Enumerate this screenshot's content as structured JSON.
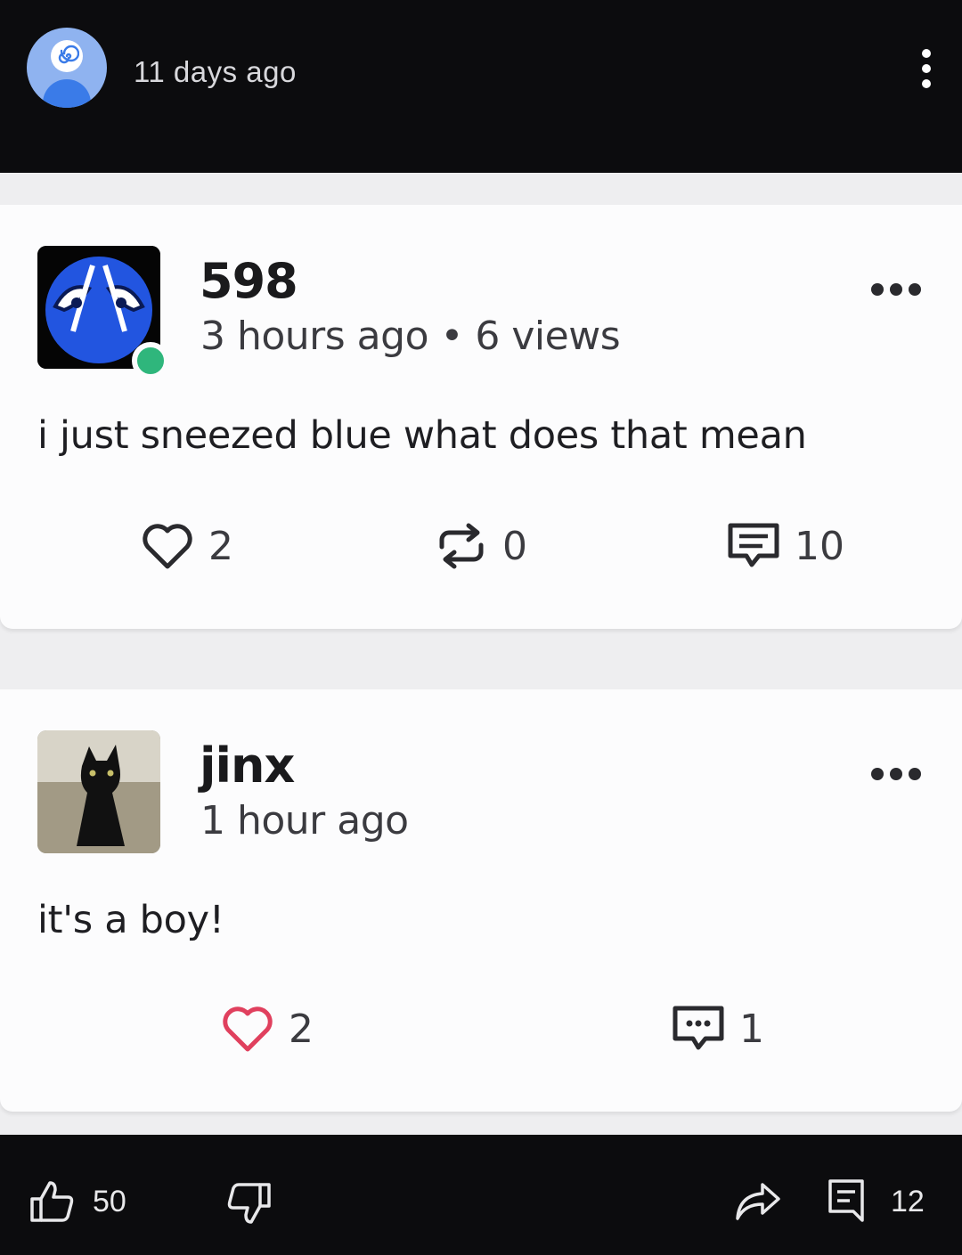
{
  "header": {
    "time": "11 days ago",
    "more_icon": "vertical-dots-icon"
  },
  "posts": [
    {
      "username": "598",
      "meta": "3 hours ago • 6 views",
      "text": "i just sneezed blue what does that mean",
      "online": true,
      "likes": "2",
      "reposts": "0",
      "comments": "10"
    },
    {
      "username": "jinx",
      "meta": "1 hour ago",
      "text": "it's a boy!",
      "likes": "2",
      "replies": "1"
    }
  ],
  "footer": {
    "likes": "50",
    "comments": "12"
  },
  "colors": {
    "background": "#0c0c0e",
    "card": "#fcfcfd",
    "online": "#2fb67c",
    "heart_red": "#e0405e"
  }
}
